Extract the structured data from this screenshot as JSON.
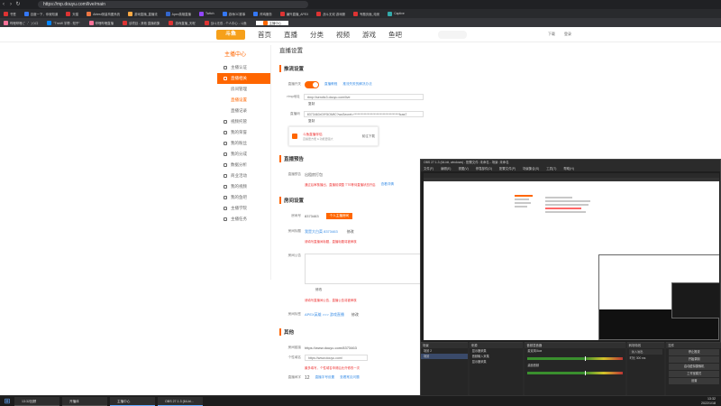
{
  "browser": {
    "url": "https://mp.douyu.com/live/main",
    "bookmarks": [
      "书签",
      "百度一下，你就知道",
      "天猫",
      "Airtest测量构图系统",
      "游戏直播_直播流",
      "Apex英雄直播",
      "Twitch",
      "游戏OC赛事",
      "炸鸡服务",
      "编外直播_APEX",
      "战斗无双 游戏服",
      "专题页面_电竞",
      "Captive"
    ],
    "tabs": [
      "哔哩哔哩 (゜-゜)つロ",
      "\"TmrW 宇帮 - 知乎\"",
      "哔哩哔哩直播",
      "该项目 - 其他 直播收集",
      "游戏直播_天呢",
      "战斗无双 - 个人中心 - 斗鱼",
      "主播中心"
    ]
  },
  "topnav": {
    "logo": "斗鱼",
    "links": [
      "首页",
      "直播",
      "分类",
      "视频",
      "游戏",
      "鱼吧"
    ],
    "right": [
      "下载",
      "登录"
    ]
  },
  "sidebar": {
    "title": "主播中心",
    "items": [
      {
        "label": "主播认证",
        "active": false
      },
      {
        "label": "直播相关",
        "active": true
      },
      {
        "label": "我的荣誉",
        "active": false
      },
      {
        "label": "我的粉丝",
        "active": false
      },
      {
        "label": "我的分成",
        "active": false
      },
      {
        "label": "数据分析",
        "active": false
      },
      {
        "label": "商业活动",
        "active": false
      },
      {
        "label": "我的视频",
        "active": false
      },
      {
        "label": "我的鱼吧",
        "active": false
      },
      {
        "label": "主播学院",
        "active": false
      },
      {
        "label": "主播任务",
        "active": false
      }
    ],
    "subitems": [
      "房间管理",
      "直播设置",
      "直播记录",
      "视频托管"
    ]
  },
  "content": {
    "page_title": "直播设置",
    "push_section": "推流设置",
    "push_toggle_label": "直播开关",
    "push_link1": "直播教程",
    "push_link2": "推流失败的解决办法",
    "rtmp_label": "rtmp地址",
    "rtmp_value": "rtmp://sendtc3.douyu.com/live",
    "copy": "复制",
    "key_label": "直播码",
    "key_value": "8373463rGfY5OMfC?wsSecret=************************************fcas7",
    "promo_title": "斗鱼直播伴侣",
    "promo_sub": "直播更方便 & 功能更强大",
    "promo_btn": "前往下载",
    "notice_section": "直播预告",
    "notice_label": "直播预告",
    "notice_value": "出租房打包",
    "notice_tip": "通过后审核播出，直播前调整 TTS等待直播状态开启",
    "notice_link": "查看详情",
    "room_section": "房间设置",
    "room_label": "房间号",
    "room_value": "8373463",
    "room_btn": "个人主播房间",
    "title_label": "房间标题",
    "title_value": "我是大白菜 8373463",
    "edit": "修改",
    "title_tip": "请填写直播间标题，直播标题将被审核",
    "announce_label": "房间公告",
    "announce_tip": "请填写直播间公告，直播公告将被审核",
    "tags_label": "房间标签",
    "tags_value": "APEX英雄 >>> 游戏直播",
    "other_section": "其他",
    "link_label": "房间链接",
    "link_value": "https://www.douyu.com/8373463",
    "link2_label": "个性域名",
    "link2_value": "https://www.douyu.com/",
    "link2_tip": "最多填写，个性域名申请后允许修改一次",
    "font_label": "直播间字",
    "font_value": "12",
    "font_link": "直播字号设置",
    "font_link2": "查看常见问题"
  },
  "obs": {
    "title": "OBS 27.1.3 (64-bit, windows) - 配置文件: 未命名 - 场景: 未命名",
    "menu": [
      "文件(F)",
      "编辑(E)",
      "视图(V)",
      "停靠部件(D)",
      "配置文件(P)",
      "场景集合(S)",
      "工具(T)",
      "帮助(H)"
    ],
    "docks": {
      "scenes": {
        "title": "场景",
        "items": [
          "场景 2",
          "场景"
        ]
      },
      "sources": {
        "title": "来源",
        "items": [
          "显示器采集",
          "音频输入采集",
          "显示器采集"
        ]
      },
      "mixer": {
        "title": "音频混音器",
        "items": [
          "麦克风/Aux",
          "桌面音频"
        ]
      },
      "transitions": {
        "title": "转场特效",
        "items": [
          "淡入淡出",
          "时长 300 ms"
        ]
      },
      "controls": {
        "title": "控件",
        "items": [
          "停止推流",
          "开始录制",
          "启动虚拟摄像机",
          "工作室模式",
          "设置",
          "退出"
        ]
      }
    }
  },
  "taskbar": {
    "items": [
      "13:32回顾",
      "开播体",
      "主播中心",
      "OBS 27.1.3 (64-bi..."
    ],
    "time": "13:32",
    "date": "2022/1/18"
  }
}
